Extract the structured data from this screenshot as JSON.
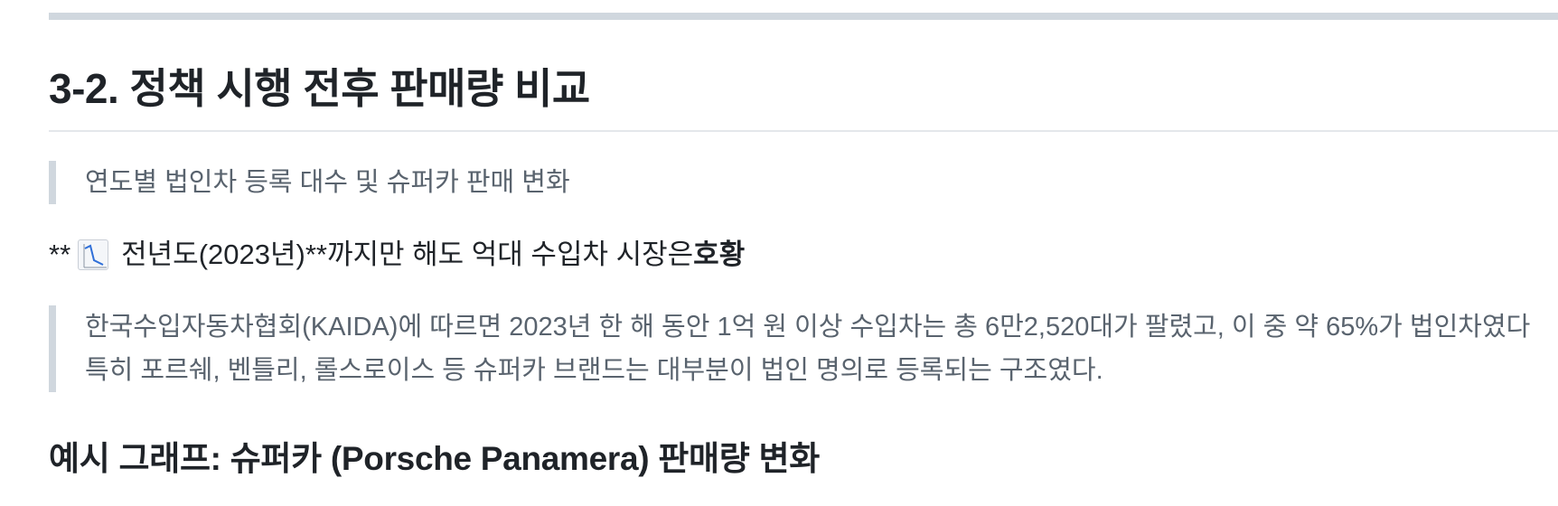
{
  "section": {
    "heading": "3-2. 정책 시행 전후 판매량 비교",
    "caption_quote": "연도별 법인차 등록 대수 및 슈퍼카 판매 변화",
    "paragraph": {
      "prefix": "**",
      "icon": "chart-decreasing-icon",
      "middle": "전년도(2023년)**까지만 해도 억대 수입차 시장은 ",
      "emphasis": "호황"
    },
    "body_quote": "한국수입자동차협회(KAIDA)에 따르면 2023년 한 해 동안 1억 원 이상 수입차는 총 6만2,520대가 팔렸고, 이 중 약 65%가 법인차였다 특히 포르쉐, 벤틀리, 롤스로이스 등 슈퍼카 브랜드는 대부분이 법인 명의로 등록되는 구조였다.",
    "subheading": "예시 그래프: 슈퍼카 (Porsche Panamera) 판매량 변화"
  },
  "colors": {
    "text": "#1f2328",
    "muted_text": "#59636e",
    "quote_border": "#d0d7de",
    "rule": "#e4e7eb"
  }
}
